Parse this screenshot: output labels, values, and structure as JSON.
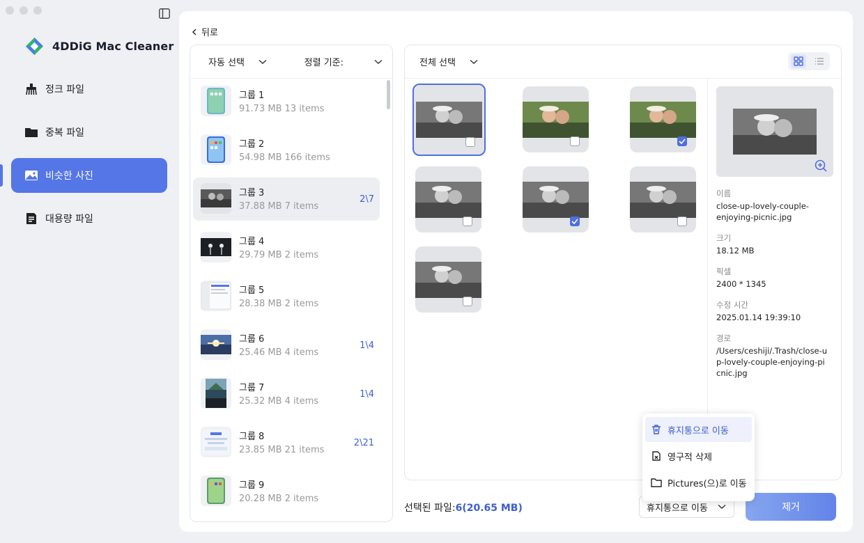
{
  "app": {
    "name": "4DDiG Mac Cleaner"
  },
  "sidebar": {
    "items": [
      {
        "label": "정크 파일",
        "icon": "junk-broom-icon"
      },
      {
        "label": "중복 파일",
        "icon": "folder-icon"
      },
      {
        "label": "비슷한 사진",
        "icon": "photo-icon"
      },
      {
        "label": "대용량 파일",
        "icon": "document-icon"
      }
    ],
    "active_index": 2
  },
  "back_label": "뒤로",
  "list": {
    "auto_select": "자동 선택",
    "sort_label": "정렬 기준:",
    "groups": [
      {
        "name": "그룹 1",
        "size": "91.73  MB",
        "items": "13 items",
        "count": ""
      },
      {
        "name": "그룹 2",
        "size": "54.98  MB",
        "items": "166 items",
        "count": ""
      },
      {
        "name": "그룹 3",
        "size": "37.88  MB",
        "items": "7 items",
        "count": "2\\7"
      },
      {
        "name": "그룹 4",
        "size": "29.79  MB",
        "items": "2 items",
        "count": ""
      },
      {
        "name": "그룹 5",
        "size": "28.38  MB",
        "items": "2 items",
        "count": ""
      },
      {
        "name": "그룹 6",
        "size": "25.46  MB",
        "items": "4 items",
        "count": "1\\4"
      },
      {
        "name": "그룹 7",
        "size": "25.32  MB",
        "items": "4 items",
        "count": "1\\4"
      },
      {
        "name": "그룹 8",
        "size": "23.85  MB",
        "items": "21 items",
        "count": "2\\21"
      },
      {
        "name": "그룹 9",
        "size": "20.28  MB",
        "items": "2 items",
        "count": ""
      }
    ]
  },
  "grid": {
    "select_all": "전체 선택",
    "photos": [
      {
        "checked": false,
        "color": false
      },
      {
        "checked": false,
        "color": true
      },
      {
        "checked": true,
        "color": true
      },
      {
        "checked": false,
        "color": false
      },
      {
        "checked": true,
        "color": false
      },
      {
        "checked": false,
        "color": false
      },
      {
        "checked": false,
        "color": false
      }
    ]
  },
  "details": {
    "name_label": "이름",
    "name_value": "close-up-lovely-couple-enjoying-picnic.jpg",
    "size_label": "크기",
    "size_value": "18.12  MB",
    "pixel_label": "픽셀",
    "pixel_value": "2400 * 1345",
    "modified_label": "수정 시간",
    "modified_value": "2025.01.14 19:39:10",
    "path_label": "경로",
    "path_value": "/Users/ceshiji/.Trash/close-up-lovely-couple-enjoying-picnic.jpg"
  },
  "menu": {
    "trash": "휴지통으로 이동",
    "delete": "영구적 삭제",
    "pictures": "Pictures(으)로 이동"
  },
  "footer": {
    "selected_label": "선택된 파일:",
    "selected_value": "6(20.65  MB)",
    "action_select": "휴지통으로 이동",
    "remove_button": "제거"
  }
}
